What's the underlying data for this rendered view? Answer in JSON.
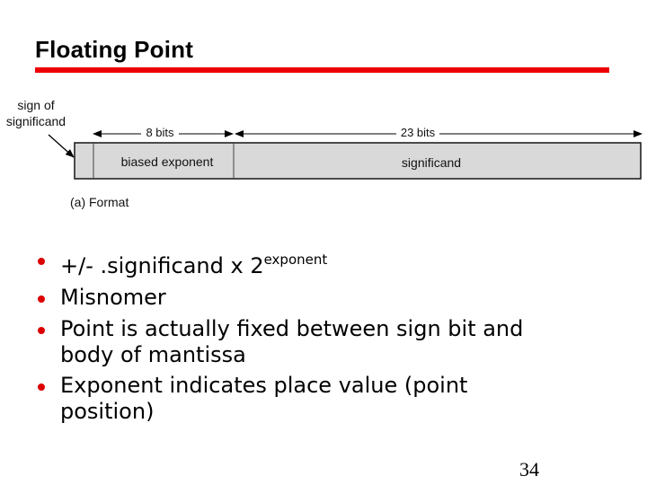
{
  "slide": {
    "title": "Floating Point",
    "page_number": "34"
  },
  "diagram": {
    "sign_label_line1": "sign of",
    "sign_label_line2": "significand",
    "exponent_bits": "8 bits",
    "significand_bits": "23 bits",
    "exponent_field": "biased exponent",
    "significand_field": "significand",
    "caption": "(a) Format"
  },
  "bullets": [
    {
      "text": "+/- .significand x 2",
      "superscript": "exponent"
    },
    {
      "text": "Misnomer"
    },
    {
      "text": "Point is actually fixed between sign bit and",
      "continuation": "body of mantissa"
    },
    {
      "text": "Exponent indicates place value (point",
      "continuation": "position)"
    }
  ],
  "colors": {
    "accent_rule": "#ee0000",
    "bullet": "#dd0000",
    "field_fill": "#d9d9d9"
  }
}
